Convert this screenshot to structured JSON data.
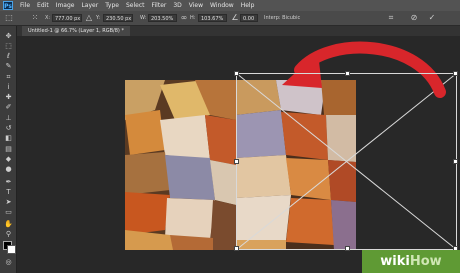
{
  "app": {
    "logo_text": "Ps"
  },
  "menu": [
    "File",
    "Edit",
    "Image",
    "Layer",
    "Type",
    "Select",
    "Filter",
    "3D",
    "View",
    "Window",
    "Help"
  ],
  "options_bar": {
    "x_label": "X:",
    "x_value": "777.00 px",
    "y_label": "Y:",
    "y_value": "230.50 px",
    "w_label": "W:",
    "w_value": "203.50%",
    "h_label": "H:",
    "h_value": "103.67%",
    "angle_value": "0.00",
    "interp_label": "H:",
    "interp_value": "0.00",
    "mode_label": "Interp: Bicubic"
  },
  "document_tab": {
    "title": "Untitled-1 @ 66.7% (Layer 1, RGB/8) *"
  },
  "tools": [
    "move",
    "marquee",
    "lasso",
    "quick-select",
    "crop",
    "eyedropper",
    "healing",
    "brush",
    "stamp",
    "history",
    "eraser",
    "gradient",
    "blur",
    "dodge",
    "pen",
    "type",
    "path-select",
    "shape",
    "hand",
    "zoom"
  ],
  "watermark": {
    "part1": "wiki",
    "part2": "How"
  },
  "colors": {
    "arrow": "#d8262b",
    "accent": "#5f9a34"
  }
}
